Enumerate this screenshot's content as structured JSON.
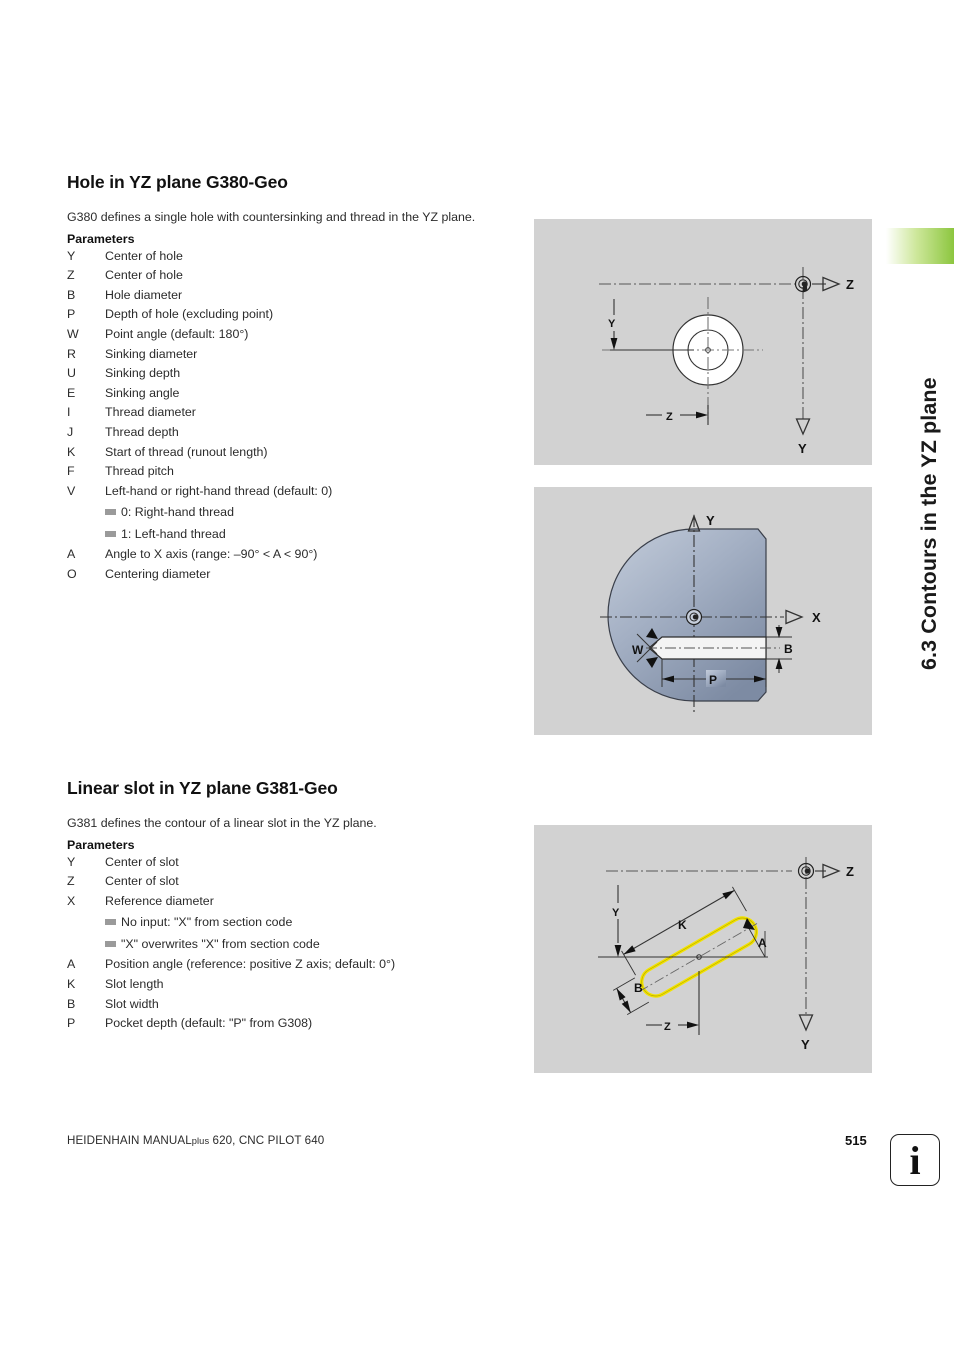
{
  "running_head": {
    "text": "6.3 Contours in the YZ plane",
    "tab_color": "#8cc63f"
  },
  "sections": [
    {
      "title": "Hole in YZ plane G380-Geo",
      "intro": "G380 defines a single hole with countersinking and thread in the YZ plane.",
      "params_label": "Parameters",
      "params": [
        {
          "key": "Y",
          "desc": "Center of hole"
        },
        {
          "key": "Z",
          "desc": "Center of hole"
        },
        {
          "key": "B",
          "desc": "Hole diameter"
        },
        {
          "key": "P",
          "desc": "Depth of hole (excluding point)"
        },
        {
          "key": "W",
          "desc": "Point angle (default: 180°)"
        },
        {
          "key": "R",
          "desc": "Sinking diameter"
        },
        {
          "key": "U",
          "desc": "Sinking depth"
        },
        {
          "key": "E",
          "desc": "Sinking angle"
        },
        {
          "key": "I",
          "desc": "Thread diameter"
        },
        {
          "key": "J",
          "desc": "Thread depth"
        },
        {
          "key": "K",
          "desc": "Start of thread (runout length)"
        },
        {
          "key": "F",
          "desc": "Thread pitch"
        },
        {
          "key": "V",
          "desc": "Left-hand or right-hand thread (default: 0)"
        }
      ],
      "bullets": [
        "0: Right-hand thread",
        "1: Left-hand thread"
      ],
      "params_after": [
        {
          "key": "A",
          "desc": "Angle to X axis (range: –90° < A < 90°)"
        },
        {
          "key": "O",
          "desc": "Centering diameter"
        }
      ]
    },
    {
      "title": "Linear slot in YZ plane G381-Geo",
      "intro": "G381 defines the contour of a linear slot in the YZ plane.",
      "params_label": "Parameters",
      "params": [
        {
          "key": "Y",
          "desc": "Center of slot"
        },
        {
          "key": "Z",
          "desc": "Center of slot"
        },
        {
          "key": "X",
          "desc": "Reference diameter"
        }
      ],
      "bullets": [
        "No input: \"X\" from section code",
        "\"X\" overwrites \"X\" from section code"
      ],
      "params_after": [
        {
          "key": "A",
          "desc": "Position angle (reference: positive Z axis; default: 0°)"
        },
        {
          "key": "K",
          "desc": "Slot length"
        },
        {
          "key": "B",
          "desc": "Slot width"
        },
        {
          "key": "P",
          "desc": "Pocket depth (default: \"P\" from G308)"
        }
      ]
    }
  ],
  "figures": {
    "hole_yz_view": {
      "labels": {
        "axis_z": "Z",
        "axis_y": "Y",
        "dim_y": "Y",
        "dim_z": "Z"
      }
    },
    "hole_section_view": {
      "labels": {
        "axis_y": "Y",
        "axis_x": "X",
        "dim_b": "B",
        "dim_p": "P",
        "dim_w": "W"
      },
      "body_color": "#99a6bb"
    },
    "slot_yz_view": {
      "labels": {
        "axis_z": "Z",
        "axis_y": "Y",
        "dim_y": "Y",
        "dim_z": "Z",
        "dim_k": "K",
        "dim_b": "B",
        "dim_a": "A"
      },
      "slot_color": "#f2e300"
    }
  },
  "footer": {
    "manual_part1": "HEIDENHAIN MANUAL",
    "manual_small": "plus",
    "manual_part2": " 620, CNC PILOT 640",
    "page_number": "515",
    "info_glyph": "i"
  }
}
